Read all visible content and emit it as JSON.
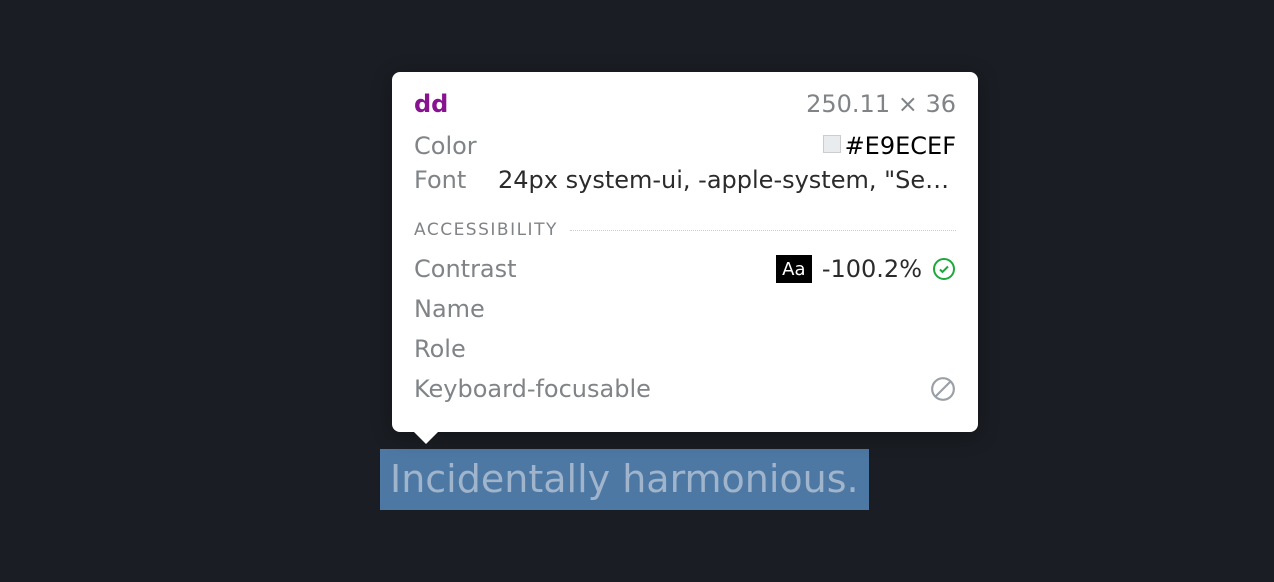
{
  "highlighted_text": "Incidentally harmonious.",
  "tooltip": {
    "element_tag": "dd",
    "dimensions": "250.11 × 36",
    "properties": {
      "color_label": "Color",
      "color_value": "#E9ECEF",
      "font_label": "Font",
      "font_value": "24px system-ui, -apple-system, \"Segoe…"
    },
    "accessibility": {
      "section_title": "ACCESSIBILITY",
      "contrast_label": "Contrast",
      "contrast_sample": "Aa",
      "contrast_value": "-100.2%",
      "name_label": "Name",
      "name_value": "",
      "role_label": "Role",
      "role_value": "",
      "focusable_label": "Keyboard-focusable"
    }
  }
}
